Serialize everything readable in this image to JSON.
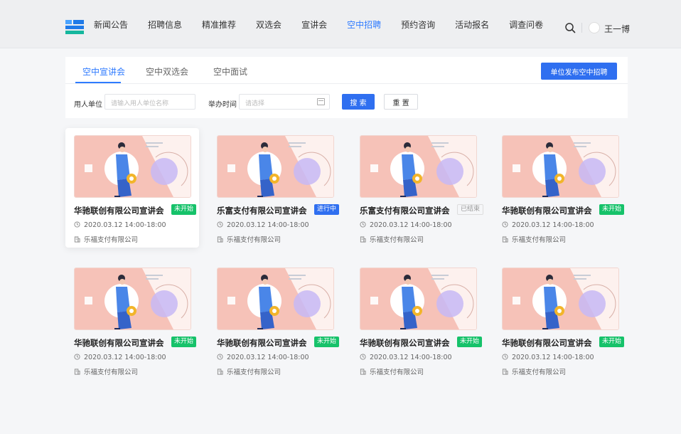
{
  "nav": {
    "items": [
      {
        "label": "新闻公告",
        "active": false
      },
      {
        "label": "招聘信息",
        "active": false
      },
      {
        "label": "精准推荐",
        "active": false
      },
      {
        "label": "双选会",
        "active": false
      },
      {
        "label": "宣讲会",
        "active": false
      },
      {
        "label": "空中招聘",
        "active": true
      },
      {
        "label": "预约咨询",
        "active": false
      },
      {
        "label": "活动报名",
        "active": false
      },
      {
        "label": "调查问卷",
        "active": false
      }
    ],
    "username": "王一博"
  },
  "tabs": [
    {
      "label": "空中宣讲会",
      "active": true
    },
    {
      "label": "空中双选会",
      "active": false
    },
    {
      "label": "空中面试",
      "active": false
    }
  ],
  "publish_button": "单位发布空中招聘",
  "filters": {
    "employer_label": "用人单位",
    "employer_placeholder": "请输入用人单位名称",
    "time_label": "举办时间",
    "time_placeholder": "请选择",
    "search_button": "搜 索",
    "reset_button": "重 置"
  },
  "colors": {
    "accent": "#2f6ff0",
    "status_not_started": "#16c26a",
    "status_in_progress": "#2f6ff0",
    "status_ended": "#999999"
  },
  "cards": [
    {
      "title": "华驰联创有限公司宣讲会",
      "status": "未开始",
      "status_type": "green",
      "time": "2020.03.12 14:00-18:00",
      "company": "乐福支付有限公司"
    },
    {
      "title": "乐富支付有限公司宣讲会",
      "status": "进行中",
      "status_type": "blue",
      "time": "2020.03.12 14:00-18:00",
      "company": "乐福支付有限公司"
    },
    {
      "title": "乐富支付有限公司宣讲会",
      "status": "已结束",
      "status_type": "gray",
      "time": "2020.03.12 14:00-18:00",
      "company": "乐福支付有限公司"
    },
    {
      "title": "华驰联创有限公司宣讲会",
      "status": "未开始",
      "status_type": "green",
      "time": "2020.03.12 14:00-18:00",
      "company": "乐福支付有限公司"
    },
    {
      "title": "华驰联创有限公司宣讲会",
      "status": "未开始",
      "status_type": "green",
      "time": "2020.03.12 14:00-18:00",
      "company": "乐福支付有限公司"
    },
    {
      "title": "华驰联创有限公司宣讲会",
      "status": "未开始",
      "status_type": "green",
      "time": "2020.03.12 14:00-18:00",
      "company": "乐福支付有限公司"
    },
    {
      "title": "华驰联创有限公司宣讲会",
      "status": "未开始",
      "status_type": "green",
      "time": "2020.03.12 14:00-18:00",
      "company": "乐福支付有限公司"
    },
    {
      "title": "华驰联创有限公司宣讲会",
      "status": "未开始",
      "status_type": "green",
      "time": "2020.03.12 14:00-18:00",
      "company": "乐福支付有限公司"
    }
  ]
}
